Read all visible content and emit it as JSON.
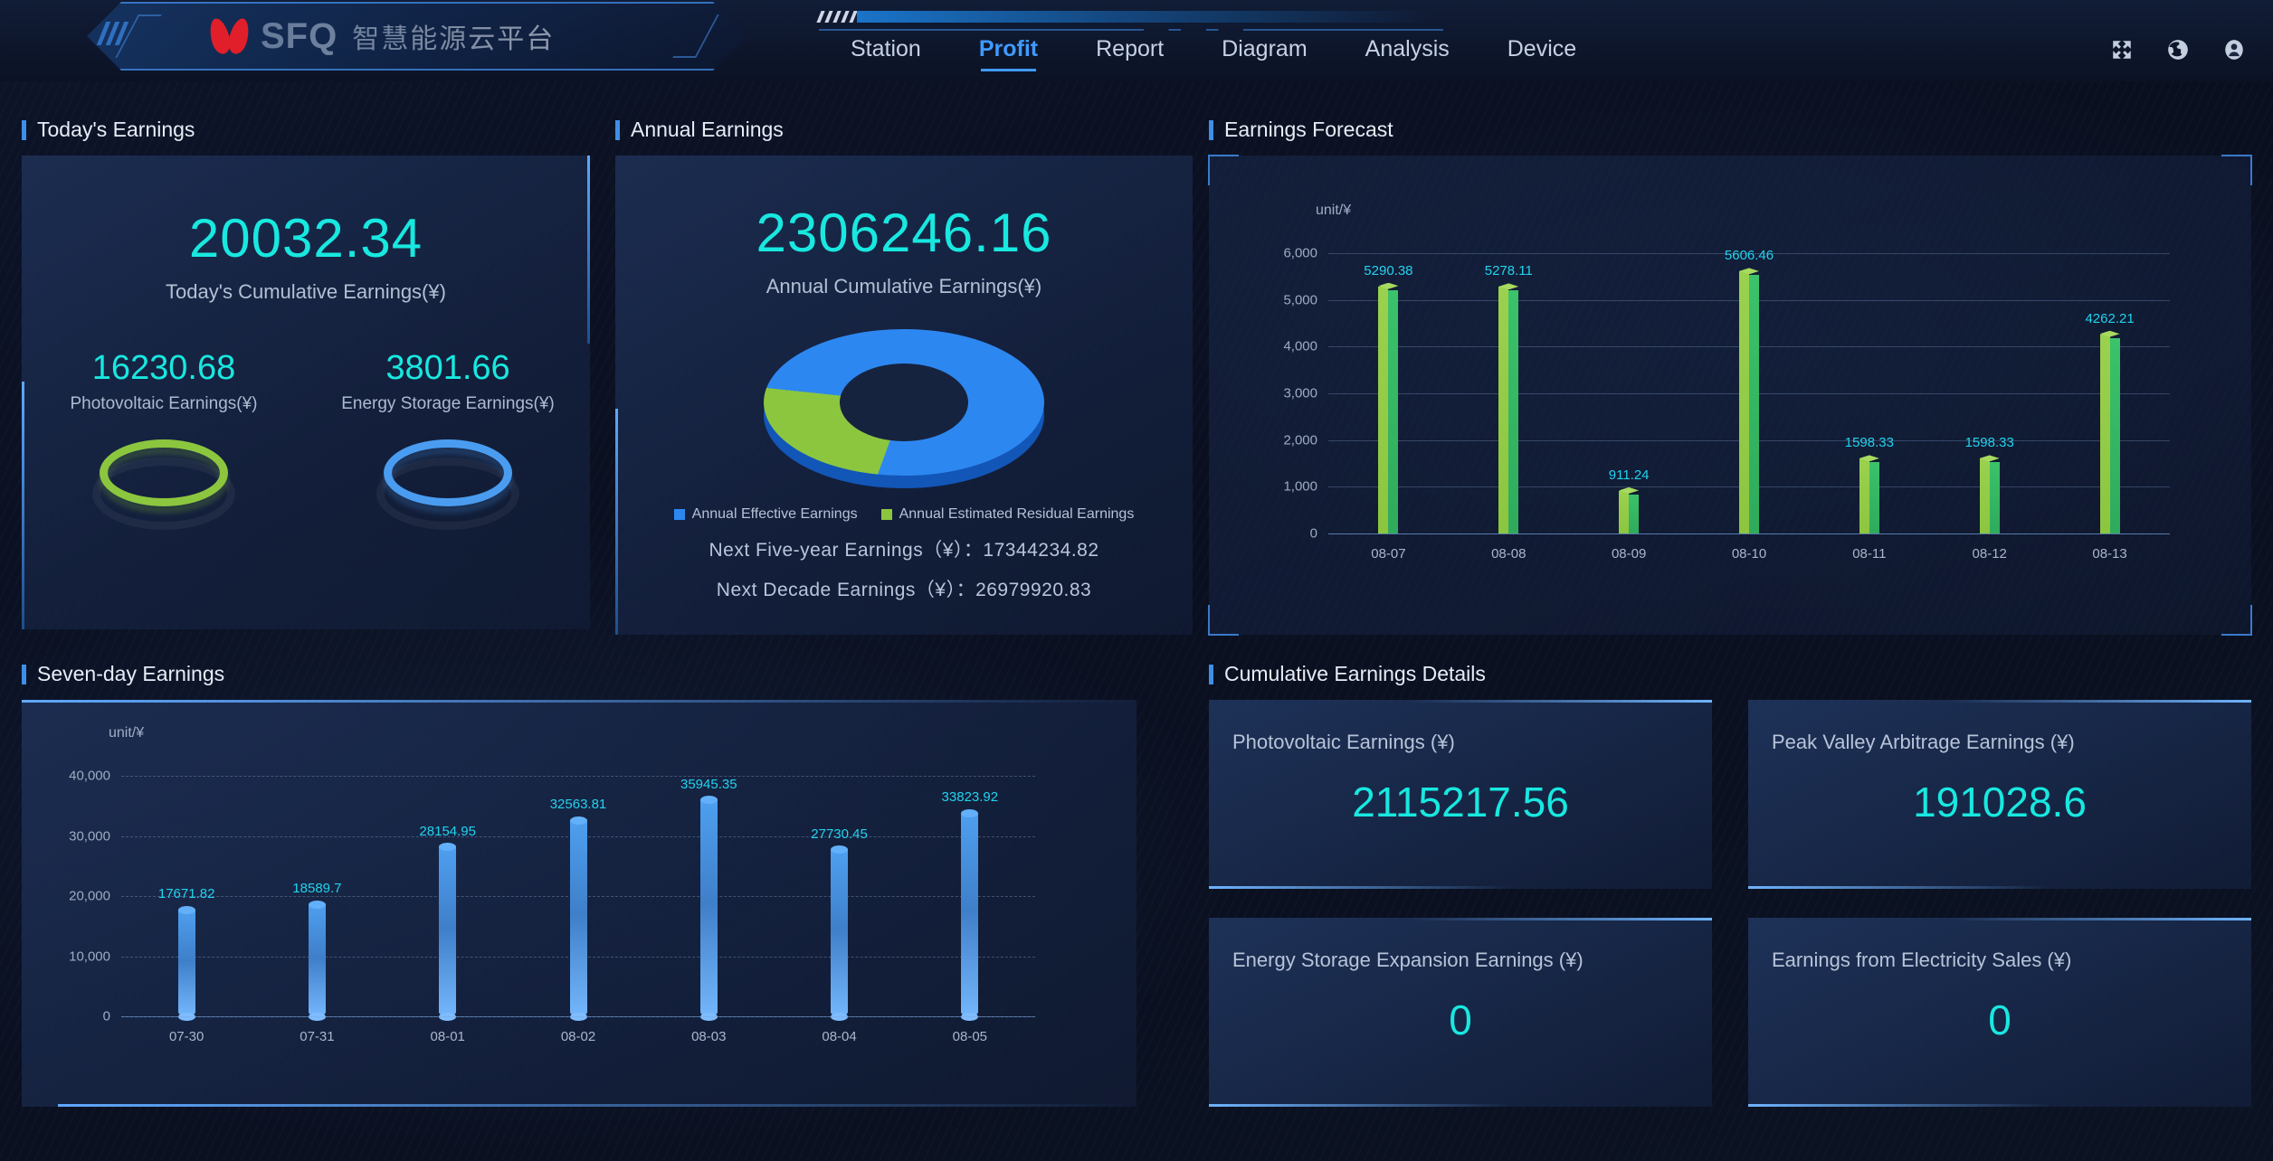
{
  "header": {
    "logo_text": "SFQ",
    "logo_cn": "智慧能源云平台",
    "nav": [
      {
        "label": "Station",
        "active": false
      },
      {
        "label": "Profit",
        "active": true
      },
      {
        "label": "Report",
        "active": false
      },
      {
        "label": "Diagram",
        "active": false
      },
      {
        "label": "Analysis",
        "active": false
      },
      {
        "label": "Device",
        "active": false
      }
    ],
    "icons": [
      "fullscreen-icon",
      "globe-icon",
      "user-icon"
    ]
  },
  "today": {
    "title": "Today's Earnings",
    "main_value": "20032.34",
    "main_label": "Today's Cumulative Earnings(¥)",
    "sub": [
      {
        "value": "16230.68",
        "label": "Photovoltaic Earnings(¥)",
        "ring_color": "#8cc63f"
      },
      {
        "value": "3801.66",
        "label": "Energy Storage Earnings(¥)",
        "ring_color": "#4a9cf0"
      }
    ]
  },
  "annual": {
    "title": "Annual Earnings",
    "main_value": "2306246.16",
    "main_label": "Annual Cumulative Earnings(¥)",
    "legend": [
      {
        "label": "Annual Effective Earnings",
        "color": "#2d87f0"
      },
      {
        "label": "Annual Estimated Residual Earnings",
        "color": "#8cc63f"
      }
    ],
    "forecast_lines": [
      "Next Five-year Earnings（¥）：17344234.82",
      "Next Decade Earnings（¥）：26979920.83"
    ]
  },
  "forecast": {
    "title": "Earnings Forecast"
  },
  "seven": {
    "title": "Seven-day Earnings"
  },
  "details": {
    "title": "Cumulative Earnings Details",
    "cards": [
      {
        "label": "Photovoltaic Earnings (¥)",
        "value": "2115217.56"
      },
      {
        "label": "Peak Valley Arbitrage Earnings (¥)",
        "value": "191028.6"
      },
      {
        "label": "Energy Storage Expansion Earnings (¥)",
        "value": "0"
      },
      {
        "label": "Earnings from Electricity Sales (¥)",
        "value": "0"
      }
    ]
  },
  "chart_data": [
    {
      "type": "bar",
      "name": "earnings-forecast",
      "title": "Earnings Forecast",
      "unit": "unit/¥",
      "categories": [
        "08-07",
        "08-08",
        "08-09",
        "08-10",
        "08-11",
        "08-12",
        "08-13"
      ],
      "values": [
        5290.38,
        5278.11,
        911.24,
        5606.46,
        1598.33,
        1598.33,
        4262.21
      ],
      "yticks": [
        0,
        1000,
        2000,
        3000,
        4000,
        5000,
        6000
      ],
      "yticklabels": [
        "0",
        "1,000",
        "2,000",
        "3,000",
        "4,000",
        "5,000",
        "6,000"
      ],
      "ylim": [
        0,
        6000
      ],
      "grid": true,
      "bar_colors": [
        "#9ad14f",
        "#3bc26a"
      ],
      "label_color": "#22d3ee"
    },
    {
      "type": "bar",
      "name": "seven-day-earnings",
      "title": "Seven-day Earnings",
      "unit": "unit/¥",
      "categories": [
        "07-30",
        "07-31",
        "08-01",
        "08-02",
        "08-03",
        "08-04",
        "08-05"
      ],
      "values": [
        17671.82,
        18589.7,
        28154.95,
        32563.81,
        35945.35,
        27730.45,
        33823.92
      ],
      "yticks": [
        0,
        10000,
        20000,
        30000,
        40000
      ],
      "yticklabels": [
        "0",
        "10,000",
        "20,000",
        "30,000",
        "40,000"
      ],
      "ylim": [
        0,
        40000
      ],
      "grid": true,
      "bar_colors": [
        "#4e9ff0",
        "#74b6fb"
      ],
      "label_color": "#22d3ee"
    },
    {
      "type": "pie",
      "name": "annual-earnings-donut",
      "title": "Annual Earnings",
      "labels": [
        "Annual Effective Earnings",
        "Annual Estimated Residual Earnings"
      ],
      "values": [
        79,
        21
      ],
      "colors": [
        "#2d87f0",
        "#8cc63f"
      ],
      "donut": true,
      "legend_position": "bottom"
    }
  ]
}
